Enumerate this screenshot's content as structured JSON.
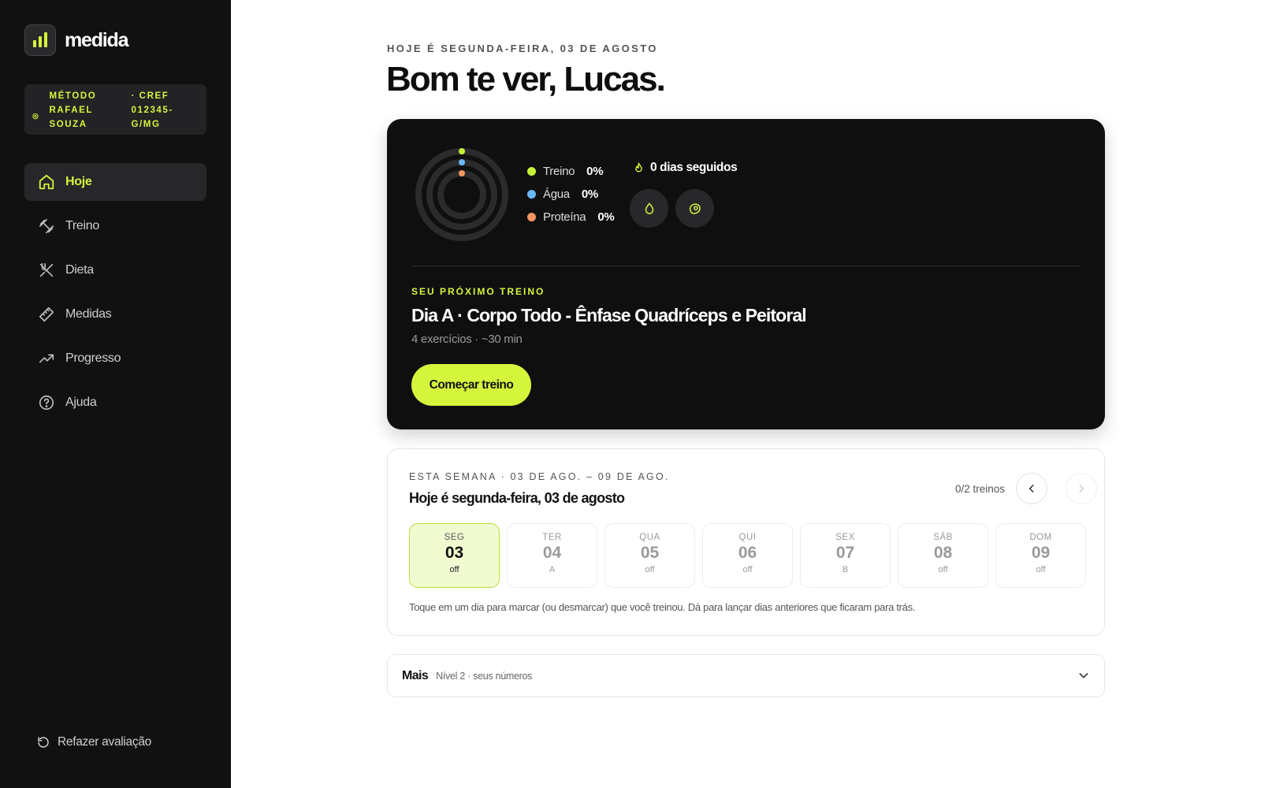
{
  "app": {
    "name": "medida"
  },
  "coach": {
    "name": "MÉTODO RAFAEL SOUZA",
    "cref": "· CREF 012345-G/MG"
  },
  "nav": {
    "items": [
      {
        "label": "Hoje",
        "icon": "home-icon",
        "active": true
      },
      {
        "label": "Treino",
        "icon": "dumbbell-icon",
        "active": false
      },
      {
        "label": "Dieta",
        "icon": "utensils-icon",
        "active": false
      },
      {
        "label": "Medidas",
        "icon": "ruler-icon",
        "active": false
      },
      {
        "label": "Progresso",
        "icon": "trending-up-icon",
        "active": false
      },
      {
        "label": "Ajuda",
        "icon": "help-circle-icon",
        "active": false
      }
    ],
    "redo_label": "Refazer avaliação"
  },
  "header": {
    "date_line": "HOJE É SEGUNDA-FEIRA, 03 DE AGOSTO",
    "greeting": "Bom te ver, Lucas."
  },
  "summary": {
    "stats": [
      {
        "label": "Treino",
        "value": "0%",
        "color": "#c6f135"
      },
      {
        "label": "Água",
        "value": "0%",
        "color": "#6ab7f5"
      },
      {
        "label": "Proteína",
        "value": "0%",
        "color": "#f39560"
      }
    ],
    "streak": "0 dias seguidos",
    "next_label": "SEU PRÓXIMO TREINO",
    "next_title": "Dia A · Corpo Todo - Ênfase Quadríceps e Peitoral",
    "next_meta": "4 exercícios · ~30 min",
    "start_label": "Começar treino"
  },
  "week": {
    "label": "ESTA SEMANA · 03 DE AGO. – 09 DE AGO.",
    "title": "Hoje é segunda-feira, 03 de agosto",
    "count": "0/2 treinos",
    "days": [
      {
        "name": "SEG",
        "date": "03",
        "tag": "off",
        "today": true
      },
      {
        "name": "TER",
        "date": "04",
        "tag": "A",
        "today": false
      },
      {
        "name": "QUA",
        "date": "05",
        "tag": "off",
        "today": false
      },
      {
        "name": "QUI",
        "date": "06",
        "tag": "off",
        "today": false
      },
      {
        "name": "SEX",
        "date": "07",
        "tag": "B",
        "today": false
      },
      {
        "name": "SÁB",
        "date": "08",
        "tag": "off",
        "today": false
      },
      {
        "name": "DOM",
        "date": "09",
        "tag": "off",
        "today": false
      }
    ],
    "hint": "Toque em um dia para marcar (ou desmarcar) que você treinou. Dá para lançar dias anteriores que ficaram para trás."
  },
  "more": {
    "title": "Mais",
    "subtitle": "Nível 2 · seus números"
  },
  "colors": {
    "accent": "#d4f53c",
    "sidebar": "#111112",
    "card": "#0f0f10"
  }
}
